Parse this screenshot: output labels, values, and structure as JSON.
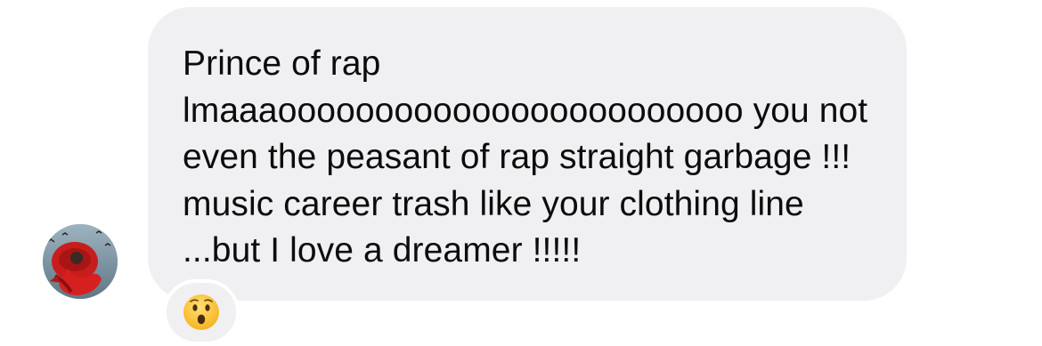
{
  "message": {
    "text": "Prince of rap\nlmaaaoooooooooooooooooooooooo you not even the peasant of rap straight garbage !!!  music career trash like your clothing line ...but I love a dreamer !!!!!"
  },
  "reaction": {
    "icon": "surprised-face-emoji",
    "color": "#ffc83d"
  },
  "colors": {
    "bubble": "#f0f0f3",
    "text": "#0c0c0c",
    "background": "#ffffff"
  }
}
